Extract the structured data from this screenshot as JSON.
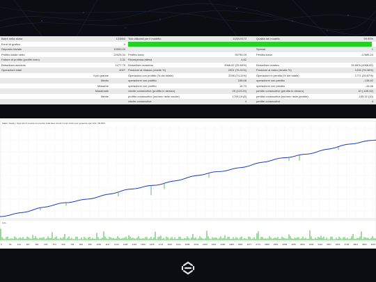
{
  "report": {
    "left_rows": [
      {
        "label": "Barre nella storia",
        "value": "123893"
      },
      {
        "label": "Errori di grafico",
        "value": "0"
      },
      {
        "label": "Deposito iniziale",
        "value": "10000.00"
      },
      {
        "label": "Profitto totale netto",
        "value": "22025.34"
      },
      {
        "label": "Fattore di profitto (profitti lordo)",
        "value": "2.31"
      },
      {
        "label": "Drawdown assoluto",
        "value": "1277.70"
      },
      {
        "label": "Operazioni totali",
        "value": "4027"
      },
      {
        "label": "il più grande",
        "value": ""
      },
      {
        "label": "Medio",
        "value": ""
      },
      {
        "label": "Massime",
        "value": ""
      },
      {
        "label": "Massimale",
        "value": ""
      },
      {
        "label": "Medie",
        "value": ""
      }
    ],
    "middle_rows": [
      {
        "label": "Tick utilizzati per il modello",
        "value": "113019173"
      },
      {
        "label": "",
        "value": ""
      },
      {
        "label": "",
        "value": ""
      },
      {
        "label": "Profitto lordo",
        "value": "39795.09"
      },
      {
        "label": "Ricompensa attesa",
        "value": "4.62"
      },
      {
        "label": "Drawdown massimo",
        "value": "4966.62 (25.65%)"
      },
      {
        "label": "Posizioni al ribasso (vincite %)",
        "value": "2001 (75.31%)"
      },
      {
        "label": "Operazioni con profitto (% del totale)",
        "value": "2256 (74.11%)"
      },
      {
        "label": "operazione con profitto",
        "value": "168.08"
      },
      {
        "label": "operazione con profitto",
        "value": "16.70"
      },
      {
        "label": "vincite consecutive (profitto in denaro)",
        "value": "25 (123.20)"
      },
      {
        "label": "profitto consecutivo (numero delle vincite)",
        "value": "1704.19 (8)"
      },
      {
        "label": "vincite consecutive",
        "value": "4"
      }
    ],
    "right_rows": [
      {
        "label": "Qualità del modello",
        "value": "99.90%"
      },
      {
        "label": "",
        "value": ""
      },
      {
        "label": "Spread",
        "value": "1"
      },
      {
        "label": "Perdita lorda",
        "value": "-17685.24"
      },
      {
        "label": "",
        "value": ""
      },
      {
        "label": "Drawdown relativo",
        "value": "25.65% (4966.62)"
      },
      {
        "label": "Posizioni al rialzo (vincite %)",
        "value": "1226 (76.06%)"
      },
      {
        "label": "Operazioni in perdita (% del totale)",
        "value": "1771 (25.87%)"
      },
      {
        "label": "operazione con perdita",
        "value": "-138.52"
      },
      {
        "label": "operazione con perdita",
        "value": "-15.46"
      },
      {
        "label": "perdite consecutive (perdita in denaro)",
        "value": "10 (-155.32)"
      },
      {
        "label": "perdita consecutiva (numero delle perdite)",
        "value": "-155.32 (10)"
      },
      {
        "label": "perdite consecutive",
        "value": "4"
      }
    ],
    "quality_bar_percent": 99.9,
    "quality_bar_color": "#24d024"
  },
  "chart": {
    "title": "Saldo / Equity / Ogni tick (il metodo piu preciso sulla base di tutti i tempi minimi per generare ogni tick) / 99.90%",
    "volume_label": "Lots",
    "balance_color": "#1f2fc8",
    "equity_color": "#2db32d",
    "balance_start": 10000,
    "balance_end": 32025.34,
    "x_ticks": [
      "0",
      "96",
      "191",
      "287",
      "382",
      "478",
      "574",
      "669",
      "765",
      "860",
      "956",
      "1052",
      "1147",
      "1243",
      "1338",
      "1434",
      "1530",
      "1625",
      "1721",
      "1816",
      "1912",
      "2008",
      "2103",
      "2199",
      "2294",
      "2390",
      "2486",
      "2581",
      "2677",
      "2772",
      "2868",
      "2964",
      "3059",
      "3155",
      "3250",
      "3346",
      "3442",
      "3537",
      "3633",
      "3728",
      "3824",
      "3920",
      "4015"
    ]
  },
  "footer": {
    "logo_icon": "link-chain-icon"
  }
}
